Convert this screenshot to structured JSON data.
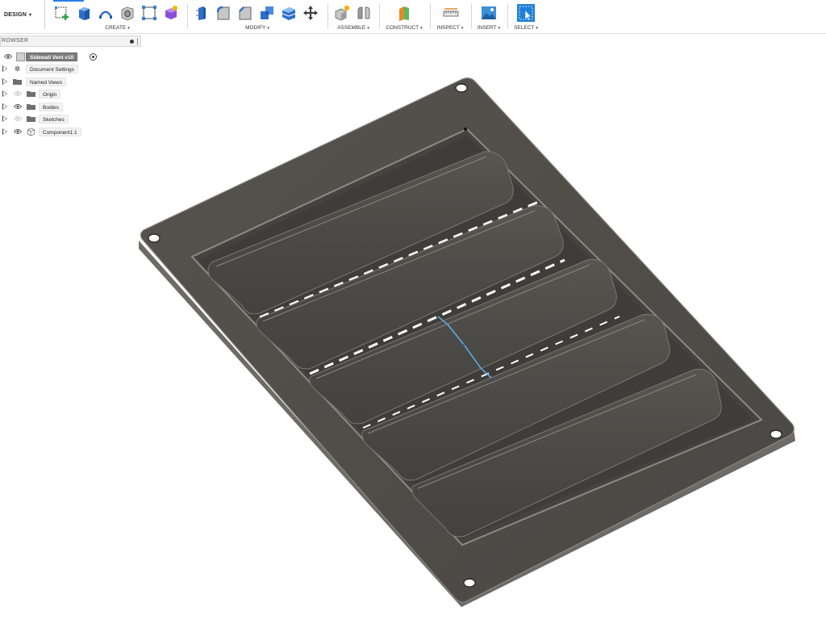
{
  "workspace": {
    "label": "DESIGN",
    "caret": "▾"
  },
  "toolbar": {
    "groups": [
      {
        "label": "CREATE",
        "icons": [
          "create-sketch-icon",
          "extrude-icon",
          "revolve-icon",
          "hole-icon",
          "pattern-icon",
          "create-form-icon"
        ]
      },
      {
        "label": "MODIFY",
        "icons": [
          "press-pull-icon",
          "fillet-icon",
          "chamfer-icon",
          "combine-icon",
          "offset-face-icon",
          "move-icon"
        ]
      },
      {
        "label": "ASSEMBLE",
        "icons": [
          "new-component-icon",
          "joint-icon"
        ]
      },
      {
        "label": "CONSTRUCT",
        "icons": [
          "offset-plane-icon"
        ]
      },
      {
        "label": "INSPECT",
        "icons": [
          "measure-icon"
        ]
      },
      {
        "label": "INSERT",
        "icons": [
          "insert-image-icon"
        ]
      },
      {
        "label": "SELECT",
        "icons": [
          "select-icon"
        ]
      }
    ],
    "caret": "▾",
    "accent": "#2b7de9"
  },
  "browser": {
    "title": "ROWSER",
    "root": {
      "label": "Sidewall Vent v10"
    },
    "items": [
      {
        "label": "Document Settings",
        "icon": "gear-icon"
      },
      {
        "label": "Named Views",
        "icon": "folder-icon"
      },
      {
        "label": "Origin",
        "icon": "folder-icon"
      },
      {
        "label": "Bodies",
        "icon": "folder-icon"
      },
      {
        "label": "Sketches",
        "icon": "folder-icon"
      },
      {
        "label": "Component1:1",
        "icon": "component-icon"
      }
    ]
  },
  "model": {
    "name": "sidewall-vent",
    "louver_count": 5,
    "mount_holes": 4,
    "body_color": "#4e4c48",
    "edge_color": "#8a8680",
    "sketch_line_color": "#5aa9e6"
  }
}
